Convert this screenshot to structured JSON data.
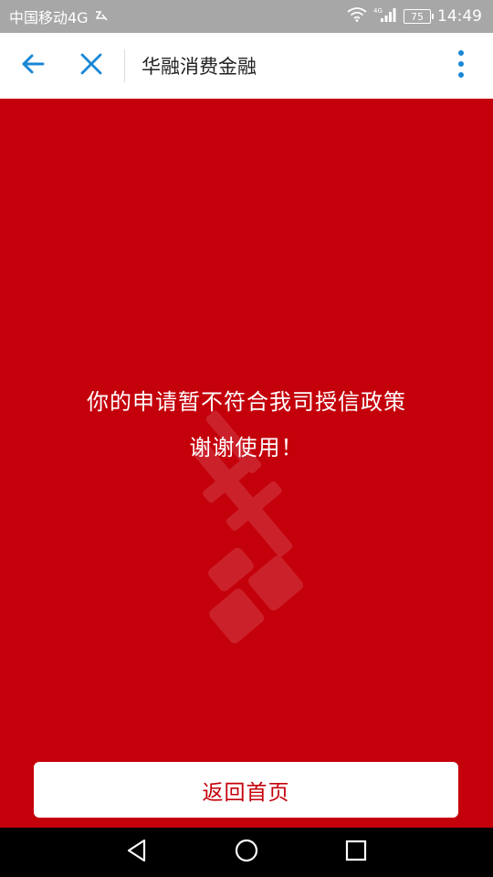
{
  "status_bar": {
    "carrier": "中国移动4G",
    "signal_label": "4G",
    "battery": "75",
    "time": "14:49"
  },
  "title_bar": {
    "title": "华融消费金融"
  },
  "content": {
    "message_line1": "你的申请暂不符合我司授信政策",
    "message_line2": "谢谢使用！",
    "home_button_label": "返回首页"
  },
  "colors": {
    "brand_red": "#c4000b",
    "accent_blue": "#1a87d6"
  },
  "icons": {
    "back": "arrow-left-icon",
    "close": "close-icon",
    "more": "more-vertical-icon",
    "nav_back": "triangle-back-icon",
    "nav_home": "circle-home-icon",
    "nav_recents": "square-recents-icon"
  }
}
